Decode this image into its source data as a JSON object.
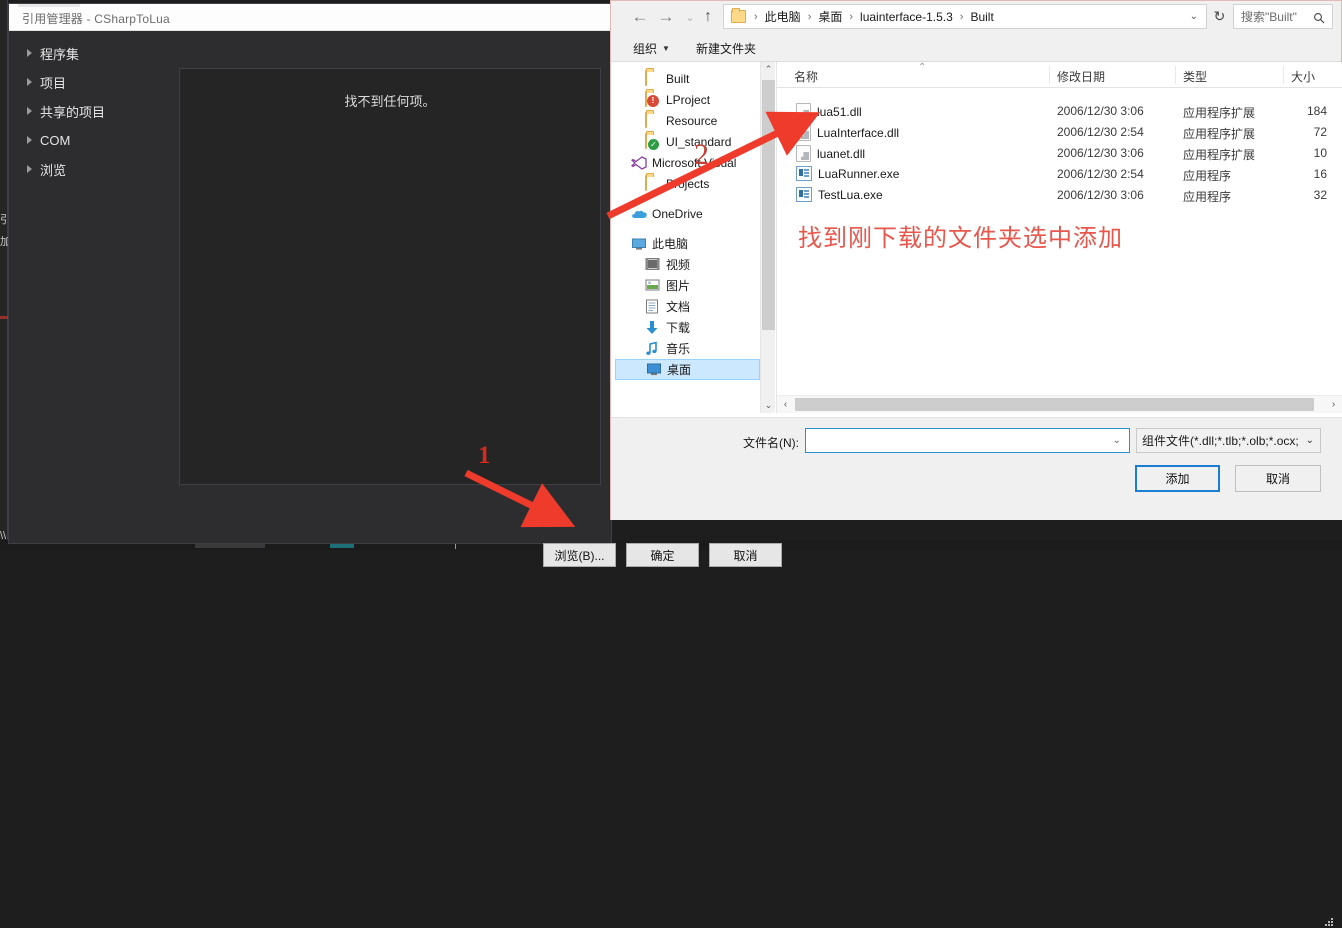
{
  "vs_dialog": {
    "title": "引用管理器 - CSharpToLua",
    "categories": [
      {
        "label": "程序集"
      },
      {
        "label": "项目"
      },
      {
        "label": "共享的项目"
      },
      {
        "label": "COM"
      },
      {
        "label": "浏览"
      }
    ],
    "empty_message": "找不到任何项。",
    "buttons": {
      "browse": "浏览(B)...",
      "ok": "确定",
      "cancel": "取消"
    }
  },
  "explorer": {
    "nav": {
      "back_icon": "←",
      "forward_icon": "→",
      "recent_icon": "⌄",
      "up_icon": "↑"
    },
    "breadcrumbs": [
      "此电脑",
      "桌面",
      "luainterface-1.5.3",
      "Built"
    ],
    "breadcrumb_separator": "›",
    "address_caret": "⌄",
    "refresh_icon": "↻",
    "search": {
      "placeholder": "搜索\"Built\"",
      "icon": "search-icon"
    },
    "commands": {
      "organize": "组织",
      "new_folder": "新建文件夹",
      "caret": "▼"
    },
    "toolbar_icons": [
      "view-list-icon",
      "chevron-down-icon",
      "preview-pane-icon",
      "help-icon"
    ],
    "help_glyph": "?",
    "tree": [
      {
        "label": "Built",
        "icon": "folder-icon",
        "selected": false,
        "indent": 30
      },
      {
        "label": "LProject",
        "icon": "folder-error-icon",
        "selected": false,
        "indent": 30
      },
      {
        "label": "Resource",
        "icon": "folder-icon",
        "selected": false,
        "indent": 30
      },
      {
        "label": "UI_standard",
        "icon": "folder-sync-icon",
        "selected": false,
        "indent": 30
      },
      {
        "label": "Microsoft Visual",
        "icon": "visual-studio-icon",
        "selected": false,
        "indent": 16
      },
      {
        "label": "Projects",
        "icon": "folder-icon",
        "selected": false,
        "indent": 30
      },
      {
        "label": "OneDrive",
        "icon": "onedrive-icon",
        "selected": false,
        "indent": 16
      },
      {
        "label": "此电脑",
        "icon": "this-pc-icon",
        "selected": false,
        "indent": 16
      },
      {
        "label": "视频",
        "icon": "videos-icon",
        "selected": false,
        "indent": 30
      },
      {
        "label": "图片",
        "icon": "pictures-icon",
        "selected": false,
        "indent": 30
      },
      {
        "label": "文档",
        "icon": "documents-icon",
        "selected": false,
        "indent": 30
      },
      {
        "label": "下载",
        "icon": "downloads-icon",
        "selected": false,
        "indent": 30
      },
      {
        "label": "音乐",
        "icon": "music-icon",
        "selected": false,
        "indent": 30
      },
      {
        "label": "桌面",
        "icon": "desktop-icon",
        "selected": true,
        "indent": 30
      }
    ],
    "columns": [
      {
        "key": "name",
        "label": "名称"
      },
      {
        "key": "modified",
        "label": "修改日期"
      },
      {
        "key": "type",
        "label": "类型"
      },
      {
        "key": "size",
        "label": "大小"
      }
    ],
    "sort_indicator": "⌃",
    "files": [
      {
        "name": "lua51.dll",
        "icon": "dll-file-icon",
        "modified": "2006/12/30 3:06",
        "type": "应用程序扩展",
        "size": "184"
      },
      {
        "name": "LuaInterface.dll",
        "icon": "dll-file-icon",
        "modified": "2006/12/30 2:54",
        "type": "应用程序扩展",
        "size": "72"
      },
      {
        "name": "luanet.dll",
        "icon": "dll-file-icon",
        "modified": "2006/12/30 3:06",
        "type": "应用程序扩展",
        "size": "10"
      },
      {
        "name": "LuaRunner.exe",
        "icon": "exe-file-icon",
        "modified": "2006/12/30 2:54",
        "type": "应用程序",
        "size": "16"
      },
      {
        "name": "TestLua.exe",
        "icon": "exe-file-icon",
        "modified": "2006/12/30 3:06",
        "type": "应用程序",
        "size": "32"
      }
    ],
    "filename": {
      "label": "文件名(N):",
      "value": "",
      "caret": "⌄"
    },
    "filter": {
      "value": "组件文件(*.dll;*.tlb;*.olb;*.ocx;",
      "caret": "⌄"
    },
    "buttons": {
      "add": "添加",
      "cancel": "取消"
    },
    "scroll": {
      "up_arrow": "⌃",
      "down_arrow": "⌄",
      "left_arrow": "‹",
      "right_arrow": "›"
    }
  },
  "annotations": {
    "step_one": "1",
    "step_two": "2",
    "note": "找到刚下载的文件夹选中添加",
    "color": "#e8564c",
    "arrow_color": "#ee3b2b"
  },
  "sliver": {
    "line_a": "引",
    "line_b": "加",
    "line_c": "\\\\"
  }
}
